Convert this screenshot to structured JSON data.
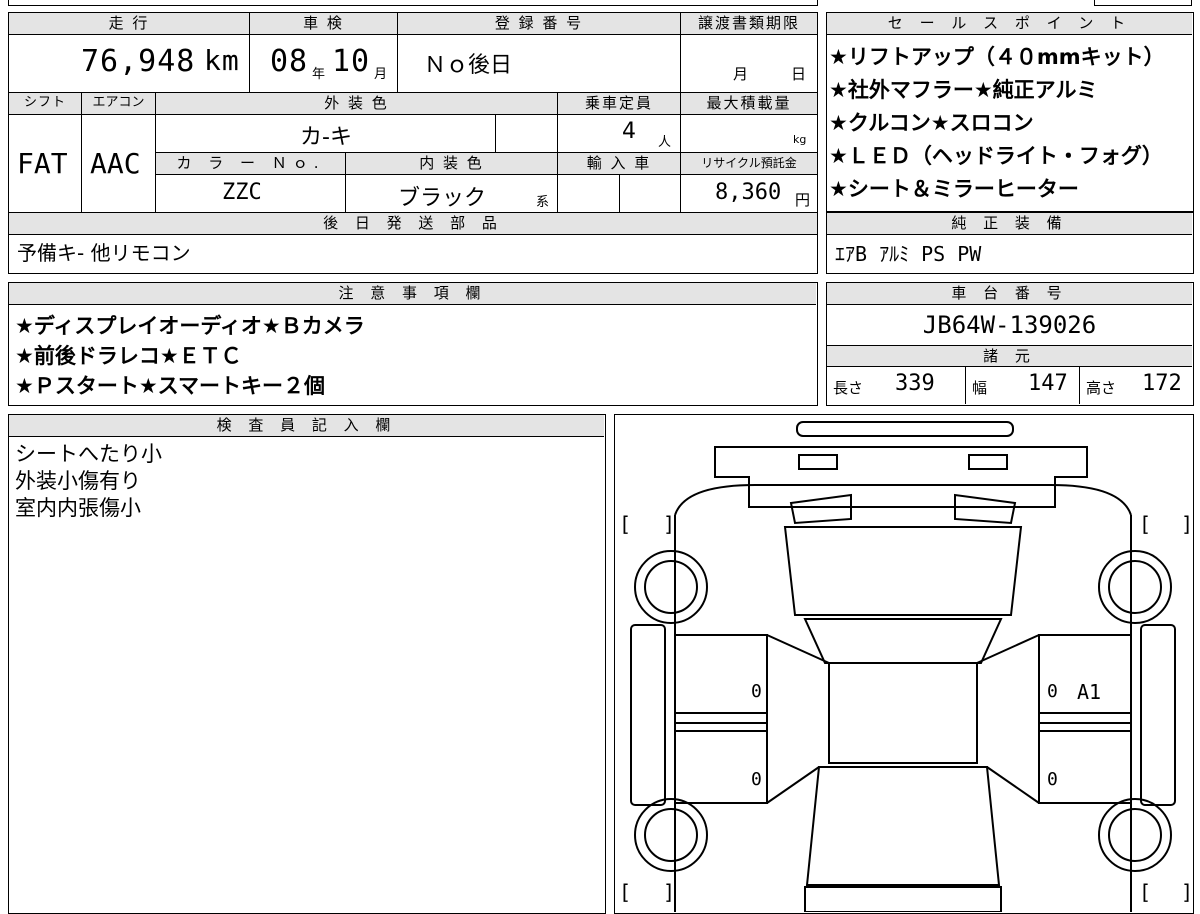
{
  "vehicle": {
    "headers": {
      "mileage": "走 行",
      "inspection": "車 検",
      "registration": "登 録 番 号",
      "transfer_deadline": "譲渡書類期限",
      "shift": "シフト",
      "aircon": "エアコン",
      "exterior_color": "外 装 色",
      "capacity": "乗車定員",
      "max_load": "最大積載量",
      "color_no": "カ ラ ー Ｎｏ.",
      "interior_color": "内 装 色",
      "import": "輸 入 車",
      "recycle": "リサイクル預託金"
    },
    "mileage_value": "76,948",
    "mileage_unit": "km",
    "inspection_year": "08",
    "year_unit": "年",
    "inspection_month": "10",
    "month_unit": "月",
    "registration_value": "Ｎｏ後日",
    "transfer_month_unit": "月",
    "transfer_day_unit": "日",
    "shift_value": "FAT",
    "aircon_value": "AAC",
    "exterior_color_value": "カ-キ",
    "capacity_value": "4",
    "capacity_unit": "人",
    "max_load_unit": "kg",
    "color_no_value": "ZZC",
    "interior_color_value": "ブラック",
    "interior_color_suffix": "系",
    "recycle_value": "8,360",
    "recycle_unit": "円"
  },
  "later_parts": {
    "header": "後 日 発 送 部 品",
    "value": "予備キ- 他リモコン"
  },
  "sales_points": {
    "header": "セ ー ル ス ポ イ ン ト",
    "items": [
      "★リフトアップ（４０mmキット）",
      "★社外マフラー★純正アルミ",
      "★クルコン★スロコン",
      "★ＬＥＤ（ヘッドライト・フォグ）",
      "★シート＆ミラーヒーター"
    ]
  },
  "genuine_equipment": {
    "header": "純 正 装 備",
    "value": "ｴｱB ｱﾙﾐ PS PW"
  },
  "notes": {
    "header": "注 意 事 項 欄",
    "lines": [
      "★ディスプレイオーディオ★Ｂカメラ",
      "★前後ドラレコ★ＥＴＣ",
      "★Ｐスタート★スマートキー２個"
    ]
  },
  "chassis": {
    "header": "車 台 番 号",
    "value": "JB64W-139026"
  },
  "specs": {
    "header": "諸 元",
    "length_label": "長さ",
    "length_value": "339",
    "width_label": "幅",
    "width_value": "147",
    "height_label": "高さ",
    "height_value": "172"
  },
  "inspector": {
    "header": "検 査 員 記 入 欄",
    "lines": [
      "シートへたり小",
      "外装小傷有り",
      "室内内張傷小"
    ]
  },
  "diagram": {
    "marks": [
      "0",
      "0",
      "0",
      "0"
    ],
    "damage_code": "A1",
    "bracket_open": "[",
    "bracket_close": "]"
  }
}
